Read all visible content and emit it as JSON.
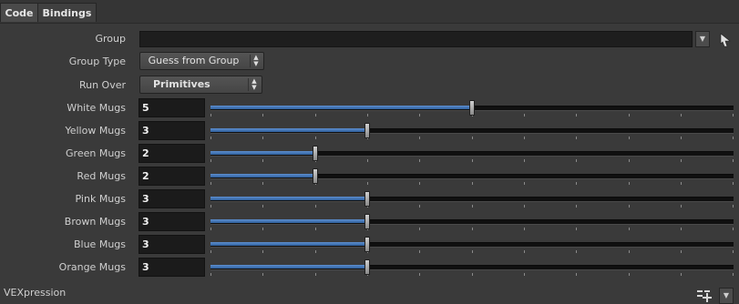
{
  "tabs": [
    {
      "label": "Code"
    },
    {
      "label": "Bindings"
    }
  ],
  "group": {
    "label": "Group",
    "value": ""
  },
  "group_type": {
    "label": "Group Type",
    "value": "Guess from Group"
  },
  "run_over": {
    "label": "Run Over",
    "value": "Primitives"
  },
  "slider_range": [
    0,
    10
  ],
  "mugs": [
    {
      "label": "White Mugs",
      "value": "5",
      "level": 5
    },
    {
      "label": "Yellow Mugs",
      "value": "3",
      "level": 3
    },
    {
      "label": "Green Mugs",
      "value": "2",
      "level": 2
    },
    {
      "label": "Red Mugs",
      "value": "2",
      "level": 2
    },
    {
      "label": "Pink Mugs",
      "value": "3",
      "level": 3
    },
    {
      "label": "Brown Mugs",
      "value": "3",
      "level": 3
    },
    {
      "label": "Blue Mugs",
      "value": "3",
      "level": 3
    },
    {
      "label": "Orange Mugs",
      "value": "3",
      "level": 3
    }
  ],
  "vexpression": {
    "label": "VEXpression"
  },
  "icons": {
    "group_menu": "chevron-down-icon",
    "group_select": "cursor-arrow-icon",
    "vex_preset": "preset-add-icon",
    "vex_menu": "chevron-down-icon"
  }
}
